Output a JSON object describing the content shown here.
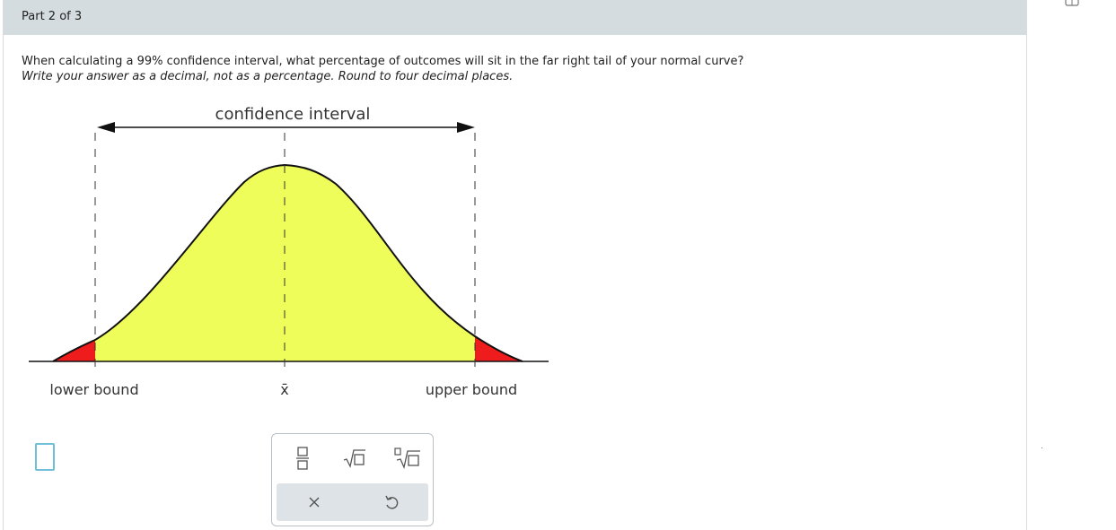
{
  "header": {
    "part_label": "Part 2 of 3"
  },
  "question": {
    "line1": "When calculating a 99% confidence interval, what percentage of outcomes will sit in the far right tail of your normal curve?",
    "line2": "Write your answer as a decimal, not as a percentage. Round to four decimal places."
  },
  "diagram": {
    "interval_label": "confidence interval",
    "lower_label": "lower bound",
    "mean_label": "x̄",
    "upper_label": "upper bound",
    "colors": {
      "body": "#eefd5a",
      "tail": "#ee1c1c",
      "stroke": "#111111"
    }
  },
  "answer": {
    "value": ""
  },
  "palette": {
    "fraction_icon": "fraction-icon",
    "sqrt_icon": "square-root-icon",
    "nth_root_icon": "nth-root-icon",
    "clear_icon": "clear-icon",
    "undo_icon": "undo-icon"
  }
}
